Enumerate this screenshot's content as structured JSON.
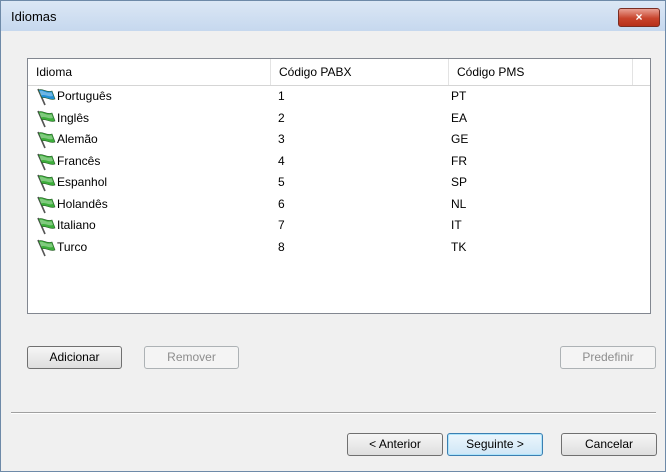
{
  "window": {
    "title": "Idiomas",
    "close_label": "×"
  },
  "table": {
    "columns": [
      "Idioma",
      "Código PABX",
      "Código PMS"
    ],
    "rows": [
      {
        "idioma": "Português",
        "pabx": "1",
        "pms": "PT",
        "flag_color": "#1f8fd6"
      },
      {
        "idioma": "Inglês",
        "pabx": "2",
        "pms": "EA",
        "flag_color": "#3cae3a"
      },
      {
        "idioma": "Alemão",
        "pabx": "3",
        "pms": "GE",
        "flag_color": "#3cae3a"
      },
      {
        "idioma": "Francês",
        "pabx": "4",
        "pms": "FR",
        "flag_color": "#3cae3a"
      },
      {
        "idioma": "Espanhol",
        "pabx": "5",
        "pms": "SP",
        "flag_color": "#3cae3a"
      },
      {
        "idioma": "Holandês",
        "pabx": "6",
        "pms": "NL",
        "flag_color": "#3cae3a"
      },
      {
        "idioma": "Italiano",
        "pabx": "7",
        "pms": "IT",
        "flag_color": "#3cae3a"
      },
      {
        "idioma": "Turco",
        "pabx": "8",
        "pms": "TK",
        "flag_color": "#3cae3a"
      }
    ]
  },
  "buttons": {
    "add": "Adicionar",
    "remove": "Remover",
    "set_default": "Predefinir",
    "previous": "< Anterior",
    "next": "Seguinte >",
    "cancel": "Cancelar"
  }
}
